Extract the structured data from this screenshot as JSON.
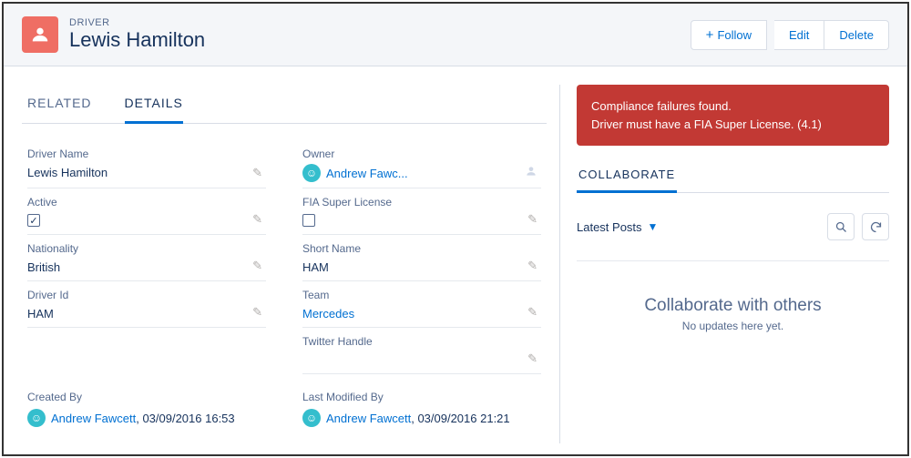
{
  "header": {
    "object_kind": "DRIVER",
    "title": "Lewis Hamilton",
    "follow_label": "Follow",
    "edit_label": "Edit",
    "delete_label": "Delete"
  },
  "tabs": {
    "related": "RELATED",
    "details": "DETAILS"
  },
  "fields": {
    "driver_name": {
      "label": "Driver Name",
      "value": "Lewis Hamilton"
    },
    "owner": {
      "label": "Owner",
      "value": "Andrew Fawc..."
    },
    "active": {
      "label": "Active",
      "checked": true
    },
    "fia": {
      "label": "FIA Super License",
      "checked": false
    },
    "nationality": {
      "label": "Nationality",
      "value": "British"
    },
    "short_name": {
      "label": "Short Name",
      "value": "HAM"
    },
    "driver_id": {
      "label": "Driver Id",
      "value": "HAM"
    },
    "team": {
      "label": "Team",
      "value": "Mercedes"
    },
    "twitter": {
      "label": "Twitter Handle",
      "value": ""
    }
  },
  "audit": {
    "created_by_label": "Created By",
    "created_by_name": "Andrew Fawcett",
    "created_by_date": "03/09/2016 16:53",
    "modified_by_label": "Last Modified By",
    "modified_by_name": "Andrew Fawcett",
    "modified_by_date": "03/09/2016 21:21"
  },
  "alert": {
    "line1": "Compliance failures found.",
    "line2": "Driver must have a FIA Super License. (4.1)"
  },
  "collab": {
    "tab": "COLLABORATE",
    "latest": "Latest Posts",
    "empty_title": "Collaborate with others",
    "empty_sub": "No updates here yet."
  }
}
